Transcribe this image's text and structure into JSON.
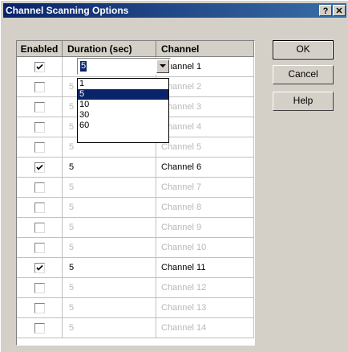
{
  "window": {
    "title": "Channel Scanning Options",
    "help_btn": "?",
    "close_btn": "✕"
  },
  "table": {
    "headers": [
      "Enabled",
      "Duration (sec)",
      "Channel"
    ],
    "rows": [
      {
        "enabled": true,
        "duration": "5",
        "channel": "Channel 1"
      },
      {
        "enabled": false,
        "duration": "5",
        "channel": "Channel 2"
      },
      {
        "enabled": false,
        "duration": "5",
        "channel": "Channel 3"
      },
      {
        "enabled": false,
        "duration": "5",
        "channel": "Channel 4"
      },
      {
        "enabled": false,
        "duration": "5",
        "channel": "Channel 5"
      },
      {
        "enabled": true,
        "duration": "5",
        "channel": "Channel 6"
      },
      {
        "enabled": false,
        "duration": "5",
        "channel": "Channel 7"
      },
      {
        "enabled": false,
        "duration": "5",
        "channel": "Channel 8"
      },
      {
        "enabled": false,
        "duration": "5",
        "channel": "Channel 9"
      },
      {
        "enabled": false,
        "duration": "5",
        "channel": "Channel 10"
      },
      {
        "enabled": true,
        "duration": "5",
        "channel": "Channel 11"
      },
      {
        "enabled": false,
        "duration": "5",
        "channel": "Channel 12"
      },
      {
        "enabled": false,
        "duration": "5",
        "channel": "Channel 13"
      },
      {
        "enabled": false,
        "duration": "5",
        "channel": "Channel 14"
      }
    ]
  },
  "combo": {
    "value": "5",
    "options": [
      "1",
      "5",
      "10",
      "30",
      "60"
    ],
    "selected_index": 1
  },
  "buttons": {
    "ok": "OK",
    "cancel": "Cancel",
    "help": "Help"
  },
  "colors": {
    "titlebar": "#0a246a",
    "selection": "#0a246a",
    "face": "#d4d0c8",
    "disabled_text": "#b8b8b8"
  }
}
